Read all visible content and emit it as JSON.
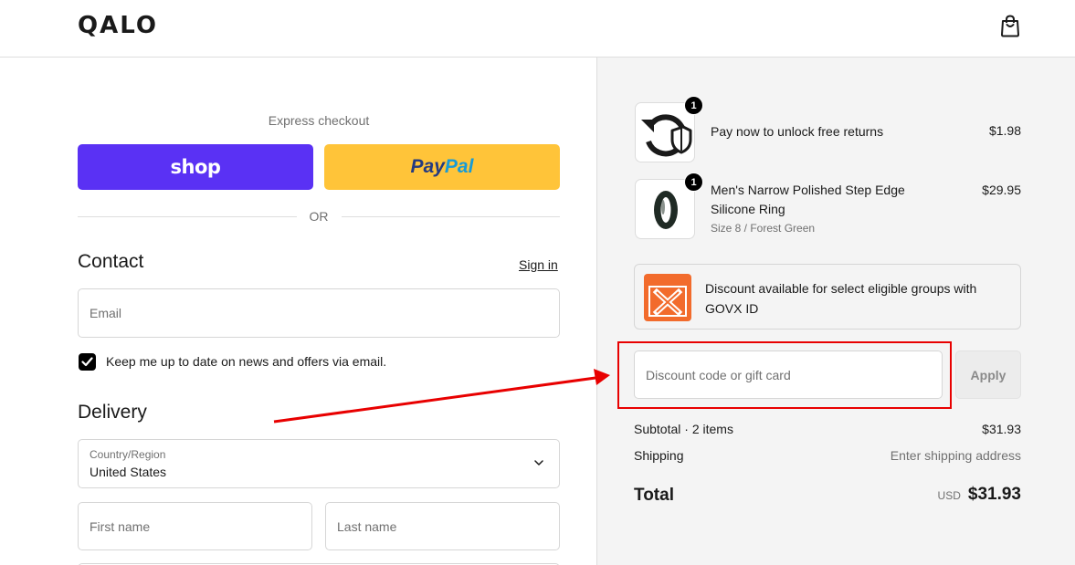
{
  "header": {
    "logo": "QALO",
    "cart_icon": "shopping-bag-icon"
  },
  "express": {
    "label": "Express checkout",
    "shop_label": "shop",
    "paypal_label_1": "Pay",
    "paypal_label_2": "Pal",
    "or": "OR"
  },
  "contact": {
    "heading": "Contact",
    "sign_in": "Sign in",
    "email_placeholder": "Email",
    "newsletter_label": "Keep me up to date on news and offers via email.",
    "newsletter_checked": true
  },
  "delivery": {
    "heading": "Delivery",
    "country_label": "Country/Region",
    "country_value": "United States",
    "first_name_placeholder": "First name",
    "last_name_placeholder": "Last name"
  },
  "order": {
    "items": [
      {
        "name": "Pay now to unlock free returns",
        "variant": "",
        "price": "$1.98",
        "quantity": "1",
        "icon": "returns-shield-icon"
      },
      {
        "name": "Men's Narrow Polished Step Edge Silicone Ring",
        "variant": "Size 8 / Forest Green",
        "price": "$29.95",
        "quantity": "1",
        "icon": "ring-image"
      }
    ],
    "govx_text": "Discount available for select eligible groups with GOVX ID",
    "govx_logo_text": "GOVX ID",
    "discount_placeholder": "Discount code or gift card",
    "apply_label": "Apply",
    "subtotal_label": "Subtotal · 2 items",
    "subtotal_value": "$31.93",
    "shipping_label": "Shipping",
    "shipping_value": "Enter shipping address",
    "total_label": "Total",
    "total_currency": "USD",
    "total_value": "$31.93"
  },
  "colors": {
    "shop_purple": "#5a31f4",
    "paypal_yellow": "#ffc439",
    "annotation_red": "#e80000",
    "govx_orange": "#f26b2c"
  }
}
